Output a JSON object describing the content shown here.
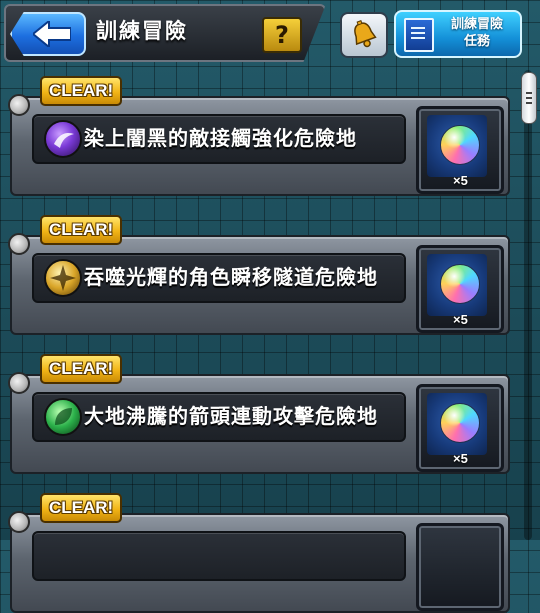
{
  "header": {
    "title": "訓練冒險",
    "help_label": "?",
    "mission_label_line1": "訓練冒險",
    "mission_label_line2": "任務"
  },
  "quests": [
    {
      "status": "CLEAR!",
      "name": "染上闇黑的敵接觸強化危險地",
      "element": "dark",
      "reward_qty": "×5"
    },
    {
      "status": "CLEAR!",
      "name": "吞噬光輝的角色瞬移隧道危險地",
      "element": "light",
      "reward_qty": "×5"
    },
    {
      "status": "CLEAR!",
      "name": "大地沸騰的箭頭連動攻擊危險地",
      "element": "wood",
      "reward_qty": "×5"
    },
    {
      "status": "CLEAR!",
      "name": "",
      "element": "",
      "reward_qty": ""
    }
  ],
  "colors": {
    "dark": "#7a3ad6",
    "light": "#d9a528",
    "wood": "#2bb04a",
    "clear_badge": "#f2b416",
    "back_button": "#1d6fe0"
  }
}
